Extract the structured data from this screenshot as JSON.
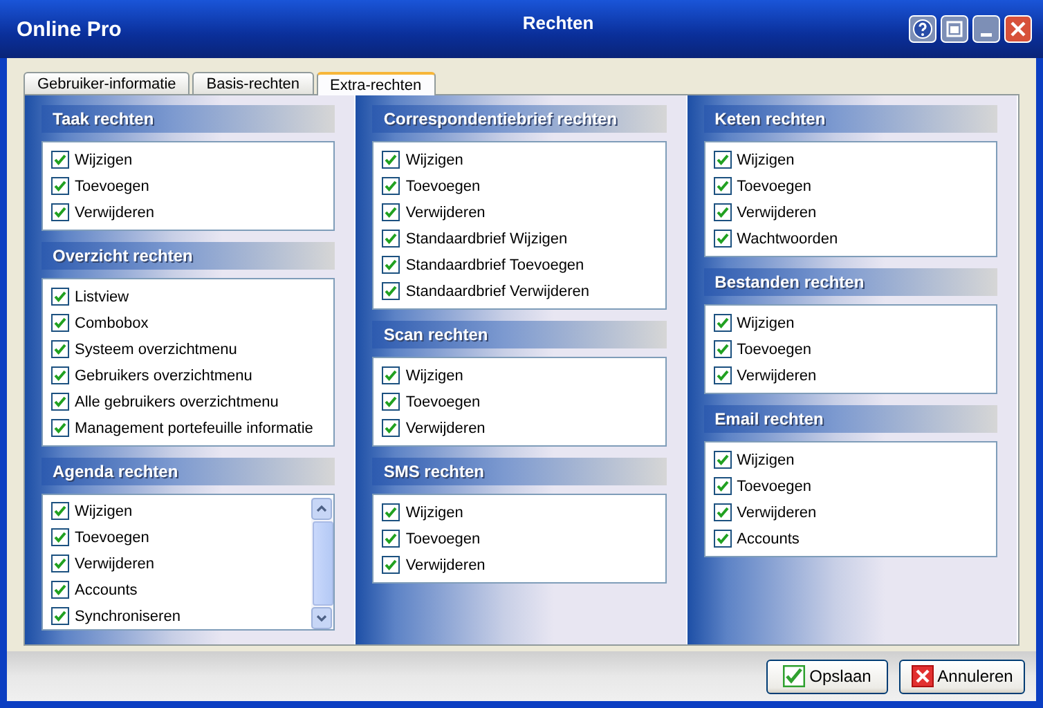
{
  "window": {
    "app_name": "Online Pro",
    "title": "Rechten"
  },
  "tabs": [
    {
      "label": "Gebruiker-informatie",
      "selected": false
    },
    {
      "label": "Basis-rechten",
      "selected": false
    },
    {
      "label": "Extra-rechten",
      "selected": true
    }
  ],
  "columns": [
    {
      "sections": [
        {
          "title": "Taak rechten",
          "scrollable": false,
          "items": [
            {
              "label": "Wijzigen",
              "checked": true
            },
            {
              "label": "Toevoegen",
              "checked": true
            },
            {
              "label": "Verwijderen",
              "checked": true
            }
          ]
        },
        {
          "title": "Overzicht rechten",
          "scrollable": false,
          "items": [
            {
              "label": "Listview",
              "checked": true
            },
            {
              "label": "Combobox",
              "checked": true
            },
            {
              "label": "Systeem overzichtmenu",
              "checked": true
            },
            {
              "label": "Gebruikers overzichtmenu",
              "checked": true
            },
            {
              "label": "Alle gebruikers overzichtmenu",
              "checked": true
            },
            {
              "label": "Management portefeuille informatie",
              "checked": true
            }
          ]
        },
        {
          "title": "Agenda rechten",
          "scrollable": true,
          "items": [
            {
              "label": "Wijzigen",
              "checked": true
            },
            {
              "label": "Toevoegen",
              "checked": true
            },
            {
              "label": "Verwijderen",
              "checked": true
            },
            {
              "label": "Accounts",
              "checked": true
            },
            {
              "label": "Synchroniseren",
              "checked": true
            }
          ]
        }
      ]
    },
    {
      "sections": [
        {
          "title": "Correspondentiebrief rechten",
          "scrollable": false,
          "items": [
            {
              "label": "Wijzigen",
              "checked": true
            },
            {
              "label": "Toevoegen",
              "checked": true
            },
            {
              "label": "Verwijderen",
              "checked": true
            },
            {
              "label": "Standaardbrief Wijzigen",
              "checked": true
            },
            {
              "label": "Standaardbrief Toevoegen",
              "checked": true
            },
            {
              "label": "Standaardbrief Verwijderen",
              "checked": true
            }
          ]
        },
        {
          "title": "Scan rechten",
          "scrollable": false,
          "items": [
            {
              "label": "Wijzigen",
              "checked": true
            },
            {
              "label": "Toevoegen",
              "checked": true
            },
            {
              "label": "Verwijderen",
              "checked": true
            }
          ]
        },
        {
          "title": "SMS rechten",
          "scrollable": false,
          "items": [
            {
              "label": "Wijzigen",
              "checked": true
            },
            {
              "label": "Toevoegen",
              "checked": true
            },
            {
              "label": "Verwijderen",
              "checked": true
            }
          ]
        }
      ]
    },
    {
      "sections": [
        {
          "title": "Keten rechten",
          "scrollable": false,
          "items": [
            {
              "label": "Wijzigen",
              "checked": true
            },
            {
              "label": "Toevoegen",
              "checked": true
            },
            {
              "label": "Verwijderen",
              "checked": true
            },
            {
              "label": "Wachtwoorden",
              "checked": true
            }
          ]
        },
        {
          "title": "Bestanden rechten",
          "scrollable": false,
          "items": [
            {
              "label": "Wijzigen",
              "checked": true
            },
            {
              "label": "Toevoegen",
              "checked": true
            },
            {
              "label": "Verwijderen",
              "checked": true
            }
          ]
        },
        {
          "title": "Email rechten",
          "scrollable": false,
          "items": [
            {
              "label": "Wijzigen",
              "checked": true
            },
            {
              "label": "Toevoegen",
              "checked": true
            },
            {
              "label": "Verwijderen",
              "checked": true
            },
            {
              "label": "Accounts",
              "checked": true
            }
          ]
        }
      ]
    }
  ],
  "buttons": [
    {
      "label": "Opslaan",
      "kind": "save"
    },
    {
      "label": "Annuleren",
      "kind": "cancel"
    }
  ]
}
